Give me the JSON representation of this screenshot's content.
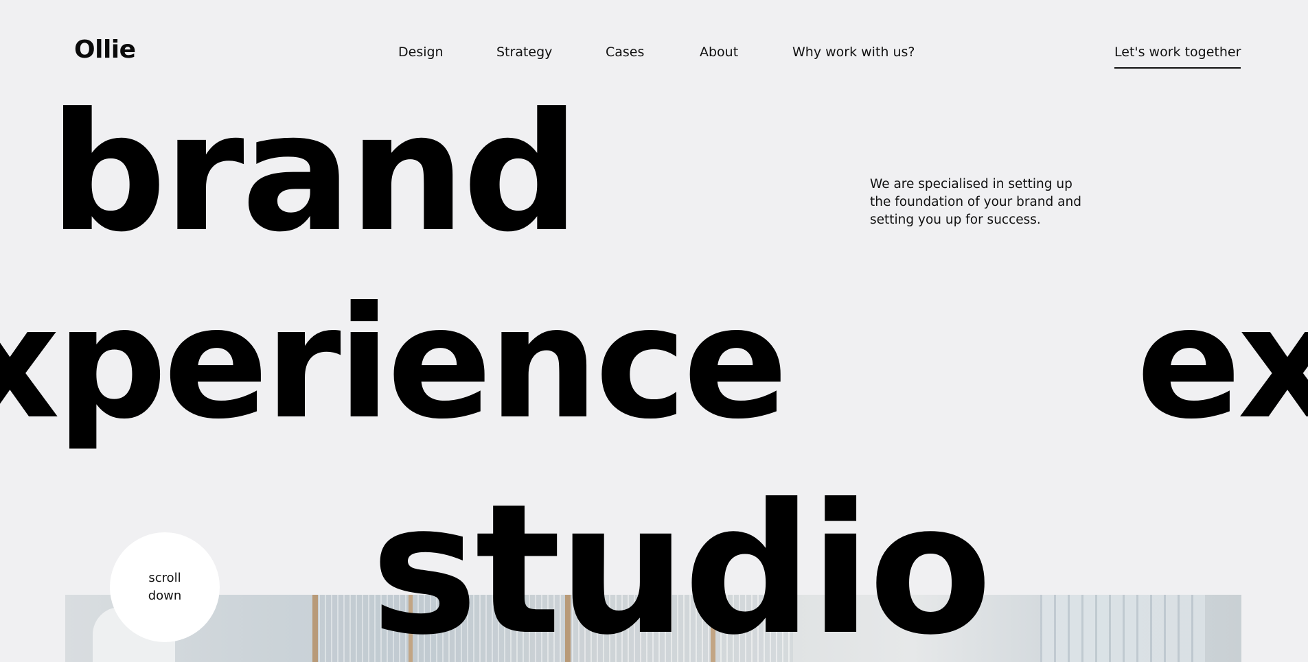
{
  "header": {
    "logo": "Ollie",
    "nav": [
      {
        "label": "Design"
      },
      {
        "label": "Strategy"
      },
      {
        "label": "Cases"
      },
      {
        "label": "About"
      },
      {
        "label": "Why work with us?"
      }
    ],
    "cta_label": "Let's work together"
  },
  "hero": {
    "word_1": "brand",
    "word_2a": "xperience",
    "word_2b": "ex",
    "word_3": "studio",
    "tagline": "We are specialised in setting up the foundation of your brand and setting you up for success."
  },
  "scroll": {
    "line_1": "scroll",
    "line_2": "down"
  },
  "colors": {
    "background": "#f0f0f2",
    "text": "#0a0a0a",
    "circle": "#ffffff"
  }
}
